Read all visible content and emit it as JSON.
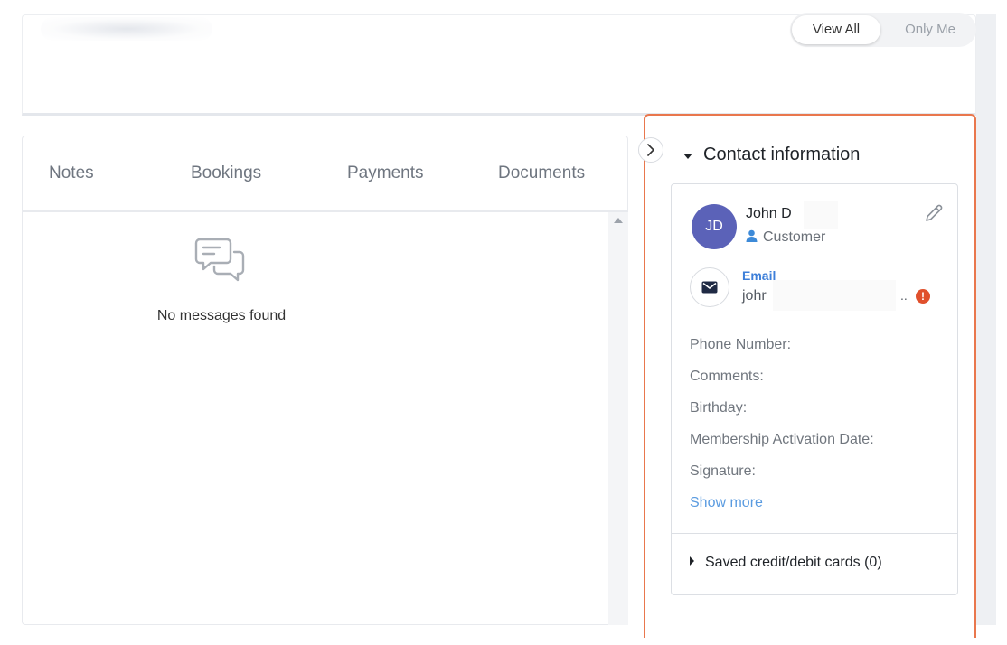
{
  "header": {
    "toggle": {
      "active": "View All",
      "inactive": "Only Me"
    }
  },
  "tabs": [
    {
      "label": "Notes"
    },
    {
      "label": "Bookings"
    },
    {
      "label": "Payments"
    },
    {
      "label": "Documents"
    }
  ],
  "messages": {
    "empty_text": "No messages found",
    "icon": "chat-bubbles-icon"
  },
  "contact": {
    "section_title": "Contact information",
    "initials": "JD",
    "name": "John D",
    "role": "Customer",
    "email_label": "Email",
    "email_value": "johr",
    "email_trailing": "..",
    "warning_glyph": "!",
    "fields": [
      "Phone Number:",
      "Comments:",
      "Birthday:",
      "Membership Activation Date:",
      "Signature:"
    ],
    "show_more": "Show more",
    "saved_cards": "Saved credit/debit cards (0)"
  },
  "colors": {
    "panel_border": "#e9774d",
    "avatar_bg": "#5b62b8",
    "link": "#5a9be0",
    "warning": "#e0502c"
  }
}
